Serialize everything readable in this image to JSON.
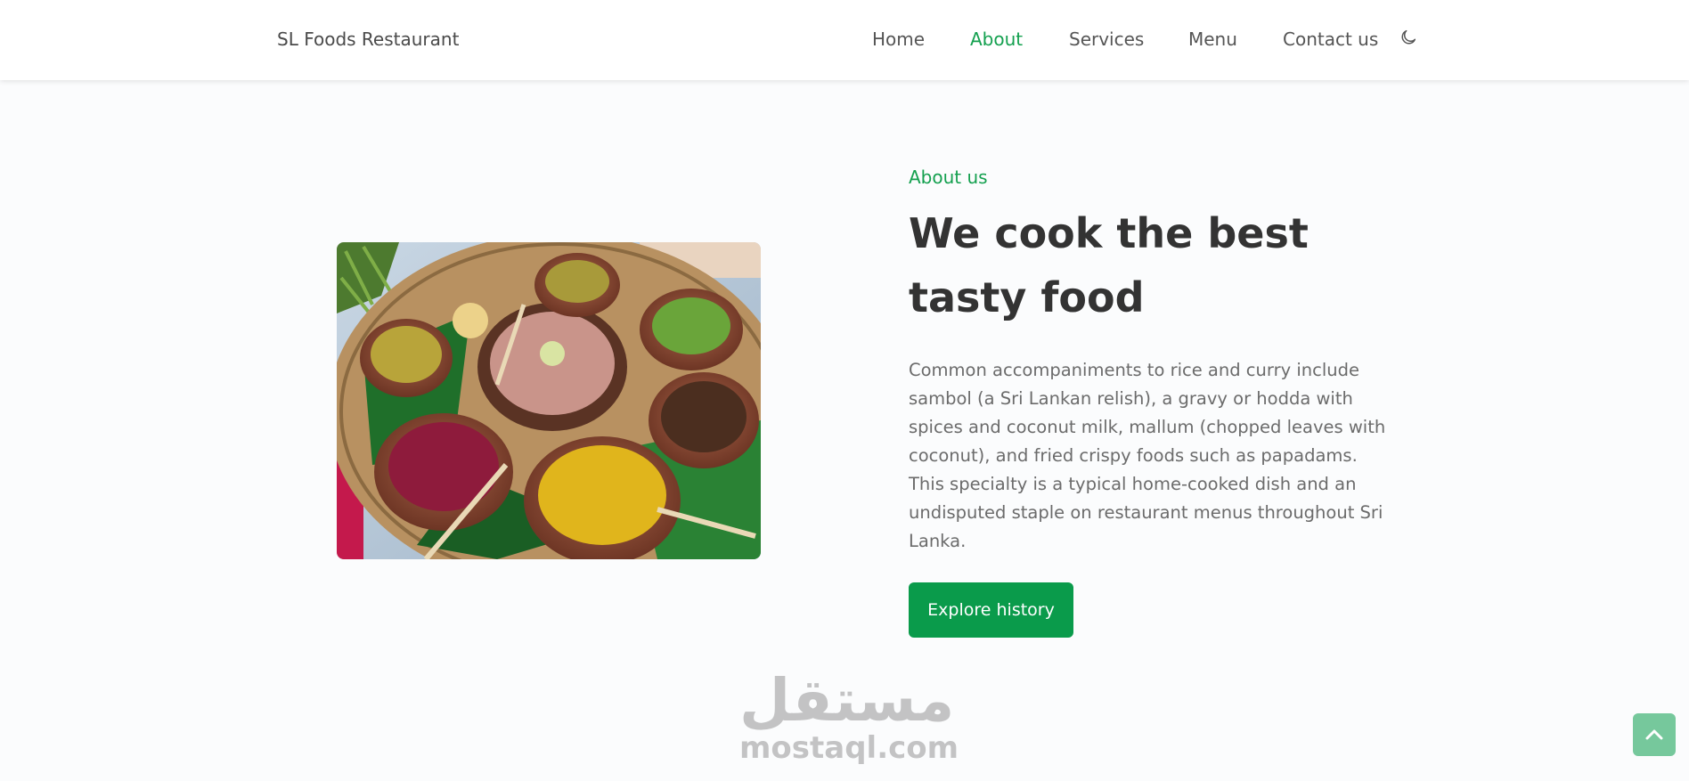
{
  "header": {
    "brand": "SL Foods Restaurant",
    "nav": [
      {
        "label": "Home",
        "active": false
      },
      {
        "label": "About",
        "active": true
      },
      {
        "label": "Services",
        "active": false
      },
      {
        "label": "Menu",
        "active": false
      },
      {
        "label": "Contact us",
        "active": false
      }
    ],
    "theme_toggle_icon": "moon-icon"
  },
  "about": {
    "eyebrow": "About us",
    "headline": "We cook the best tasty food",
    "body": "Common accompaniments to rice and curry include sambol (a Sri Lankan relish), a gravy or hodda with spices and coconut milk, mallum (chopped leaves with coconut), and fried crispy foods such as papadams. This specialty is a typical home-cooked dish and an undisputed staple on restaurant menus throughout Sri Lanka.",
    "cta_label": "Explore history",
    "image_icon": "rice-and-curry-photo"
  },
  "watermark": {
    "arabic": "مستقل",
    "latin": "mostaql.com"
  },
  "scroll_top_icon": "chevron-up-icon",
  "colors": {
    "accent": "#0a9b4b",
    "nav_active": "#14a04f",
    "text": "#333333",
    "body_text": "#6b6b6b",
    "background": "#fbfcfd"
  }
}
